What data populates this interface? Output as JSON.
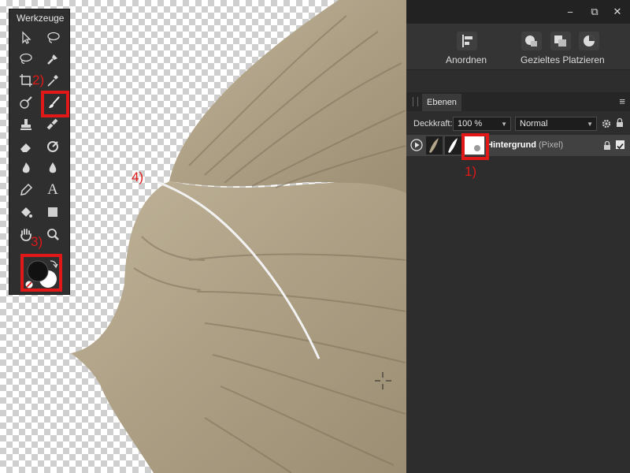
{
  "tools_panel": {
    "title": "Werkzeuge",
    "tools": [
      "move-icon",
      "lasso-freehand-icon",
      "lasso-selection-icon",
      "selection-brush-icon",
      "crop-icon",
      "color-picker-icon",
      "flood-select-icon",
      "paint-brush-icon",
      "clone-stamp-icon",
      "healing-icon",
      "eraser-icon",
      "dodge-icon",
      "burn-icon",
      "blur-icon",
      "pen-icon",
      "text-icon",
      "fill-icon",
      "rectangle-icon",
      "hand-icon",
      "zoom-icon"
    ],
    "text_tool_glyph": "A"
  },
  "annotations": {
    "a1": "1)",
    "a2": "2)",
    "a3": "3)",
    "a4": "4)"
  },
  "colors": {
    "highlight": "#e01818",
    "panel": "#2f2f2f",
    "wing": "#b5a88f"
  },
  "window": {
    "minimize_glyph": "−",
    "restore_glyph": "⧉",
    "close_glyph": "✕"
  },
  "toolbar": {
    "arrange_label": "Anordnen",
    "placement_label": "Gezieltes Platzieren"
  },
  "layers": {
    "tab_label": "Ebenen",
    "opacity_label": "Deckkraft:",
    "opacity_value": "100 %",
    "blend_mode": "Normal",
    "layer": {
      "name": "Hintergrund",
      "type": "(Pixel)"
    }
  }
}
